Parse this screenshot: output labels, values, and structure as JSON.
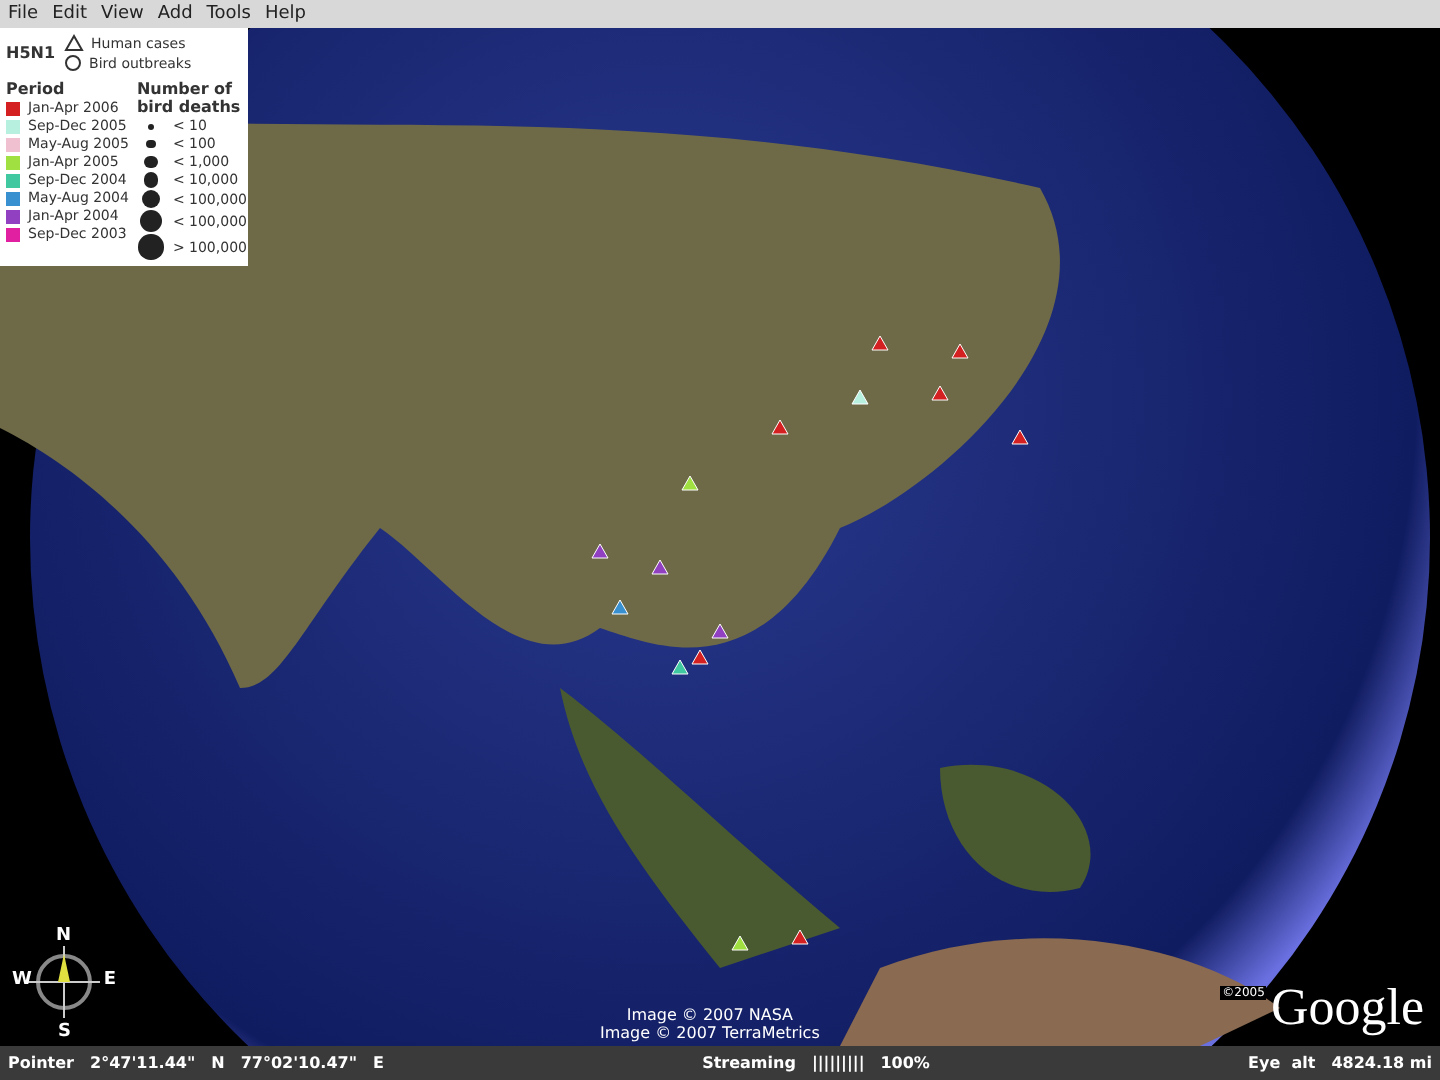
{
  "menu": [
    "File",
    "Edit",
    "View",
    "Add",
    "Tools",
    "Help"
  ],
  "legend": {
    "title": "H5N1",
    "symbols": [
      {
        "kind": "triangle",
        "label": "Human cases"
      },
      {
        "kind": "circle",
        "label": "Bird outbreaks"
      }
    ],
    "period_heading": "Period",
    "periods": [
      {
        "label": "Jan-Apr 2006",
        "color": "#d42020"
      },
      {
        "label": "Sep-Dec 2005",
        "color": "#b8f0e0"
      },
      {
        "label": "May-Aug 2005",
        "color": "#f0c0d0"
      },
      {
        "label": "Jan-Apr 2005",
        "color": "#a0e040"
      },
      {
        "label": "Sep-Dec 2004",
        "color": "#40c8a0"
      },
      {
        "label": "May-Aug 2004",
        "color": "#3890d0"
      },
      {
        "label": "Jan-Apr 2004",
        "color": "#9040c0"
      },
      {
        "label": "Sep-Dec 2003",
        "color": "#e020a0"
      }
    ],
    "deaths_heading": "Number of bird deaths",
    "sizes": [
      {
        "label": "< 10"
      },
      {
        "label": "< 100"
      },
      {
        "label": "< 1,000"
      },
      {
        "label": "< 10,000"
      },
      {
        "label": "< 100,000"
      },
      {
        "label": "< 100,000"
      },
      {
        "label": "> 100,000"
      }
    ]
  },
  "compass": {
    "north": "N",
    "west": "W",
    "east": "E",
    "south": "S"
  },
  "credits": [
    "Image © 2007 NASA",
    "Image © 2007 TerraMetrics"
  ],
  "logo": {
    "copyright": "©2005",
    "name": "Google"
  },
  "status_bar": {
    "pointer_label": "Pointer",
    "latitude": "2°47'11.44\"",
    "lat_dir": "N",
    "longitude": "77°02'10.47\"",
    "lon_dir": "E",
    "streaming_label": "Streaming",
    "streaming_bar": "|||||||||",
    "streaming_percent": "100%",
    "eye_label": "Eye  alt",
    "eye_value": "4824.18 mi"
  }
}
